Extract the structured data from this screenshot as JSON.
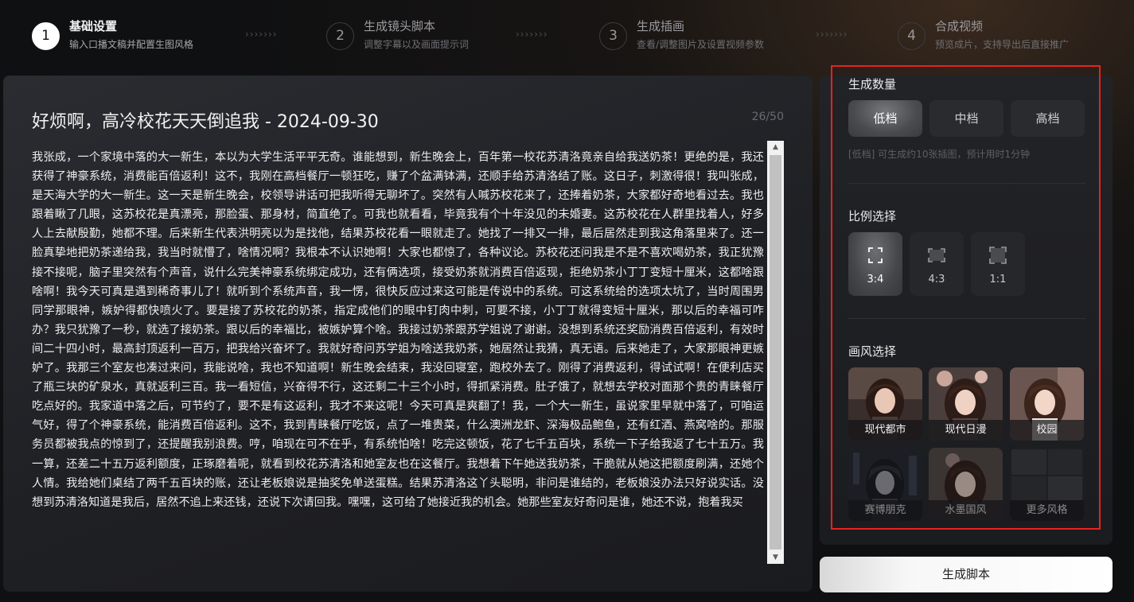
{
  "steps": [
    {
      "number": "1",
      "title": "基础设置",
      "desc": "输入口播文稿并配置生图风格",
      "active": true
    },
    {
      "number": "2",
      "title": "生成镜头脚本",
      "desc": "调整字幕以及画面提示词",
      "active": false
    },
    {
      "number": "3",
      "title": "生成插画",
      "desc": "查看/调整图片及设置视频参数",
      "active": false
    },
    {
      "number": "4",
      "title": "合成视频",
      "desc": "预览成片，支持导出后直接推广",
      "active": false
    }
  ],
  "step_arrows": "›››››››",
  "editor": {
    "title": "好烦啊，高冷校花天天倒追我 - 2024-09-30",
    "count": "26/50",
    "text": "我张成，一个家境中落的大一新生，本以为大学生活平平无奇。谁能想到，新生晚会上，百年第一校花苏清洛竟亲自给我送奶茶！更绝的是，我还获得了神豪系统，消费能百倍返利！这不，我刚在高档餐厅一顿狂吃，赚了个盆满钵满，还顺手给苏清洛结了账。这日子，刺激得很！我叫张成，是天海大学的大一新生。这一天是新生晚会，校领导讲话可把我听得无聊坏了。突然有人喊苏校花来了，还捧着奶茶，大家都好奇地看过去。我也跟着瞅了几眼，这苏校花是真漂亮，那脸蛋、那身材，简直绝了。可我也就看看，毕竟我有个十年没见的未婚妻。这苏校花在人群里找着人，好多人上去献殷勤，她都不理。后来新生代表洪明亮以为是找他，结果苏校花看一眼就走了。她找了一排又一排，最后居然走到我这角落里来了。还一脸真挚地把奶茶递给我，我当时就懵了，啥情况啊？我根本不认识她啊！大家也都惊了，各种议论。苏校花还问我是不是不喜欢喝奶茶，我正犹豫接不接呢，脑子里突然有个声音，说什么完美神豪系统绑定成功，还有俩选项，接受奶茶就消费百倍返现，拒绝奶茶小丁丁变短十厘米，这都啥跟啥啊！我今天可真是遇到稀奇事儿了！就听到个系统声音，我一愣，很快反应过来这可能是传说中的系统。可这系统给的选项太坑了，当时周围男同学那眼神，嫉妒得都快喷火了。要是接了苏校花的奶茶，指定成他们的眼中钉肉中刺，可要不接，小丁丁就得变短十厘米，那以后的幸福可咋办？我只犹豫了一秒，就选了接奶茶。跟以后的幸福比，被嫉妒算个啥。我接过奶茶跟苏学姐说了谢谢。没想到系统还奖励消费百倍返利，有效时间二十四小时，最高封顶返利一百万，把我给兴奋坏了。我就好奇问苏学姐为啥送我奶茶，她居然让我猜，真无语。后来她走了，大家那眼神更嫉妒了。我那三个室友也凑过来问，我能说啥，我也不知道啊！新生晚会结束，我没回寝室，跑校外去了。刚得了消费返利，得试试啊！在便利店买了瓶三块的矿泉水，真就返利三百。我一看短信，兴奋得不行，这还剩二十三个小时，得抓紧消费。肚子饿了，就想去学校对面那个贵的青睐餐厅吃点好的。我家道中落之后，可节约了，要不是有这返利，我才不来这呢！今天可真是爽翻了！我，一个大一新生，虽说家里早就中落了，可咱运气好，得了个神豪系统，能消费百倍返利。这不，我到青睐餐厅吃饭，点了一堆贵菜，什么澳洲龙虾、深海极品鲍鱼，还有红酒、燕窝啥的。那服务员都被我点的惊到了，还提醒我别浪费。哼，咱现在可不在乎，有系统怕啥！吃完这顿饭，花了七千五百块，系统一下子给我返了七十五万。我一算，还差二十五万返利额度，正琢磨着呢，就看到校花苏清洛和她室友也在这餐厅。我想着下午她送我奶茶，干脆就从她这把额度刷满，还她个人情。我给她们桌结了两千五百块的账，还让老板娘说是抽奖免单送蛋糕。结果苏清洛这丫头聪明，非问是谁结的，老板娘没办法只好说实话。没想到苏清洛知道是我后，居然不追上来还钱，还说下次请回我。嘿嘿，这可给了她接近我的机会。她那些室友好奇问是谁，她还不说，抱着我买"
  },
  "settings": {
    "quantity": {
      "title": "生成数量",
      "options": [
        "低档",
        "中档",
        "高档"
      ],
      "selected": "低档",
      "hint": "[低档] 可生成约10张插图，预计用时1分钟"
    },
    "ratio": {
      "title": "比例选择",
      "options": [
        "3:4",
        "4:3",
        "1:1"
      ],
      "selected": "3:4"
    },
    "style": {
      "title": "画风选择",
      "options": [
        "现代都市",
        "现代日漫",
        "校园",
        "赛博朋克",
        "水墨国风",
        "更多风格"
      ],
      "selected": "校园"
    }
  },
  "generate_button": "生成脚本",
  "colors": {
    "highlight_border": "#e8211f",
    "active_step": "#ffffff",
    "background": "#0f1012"
  }
}
